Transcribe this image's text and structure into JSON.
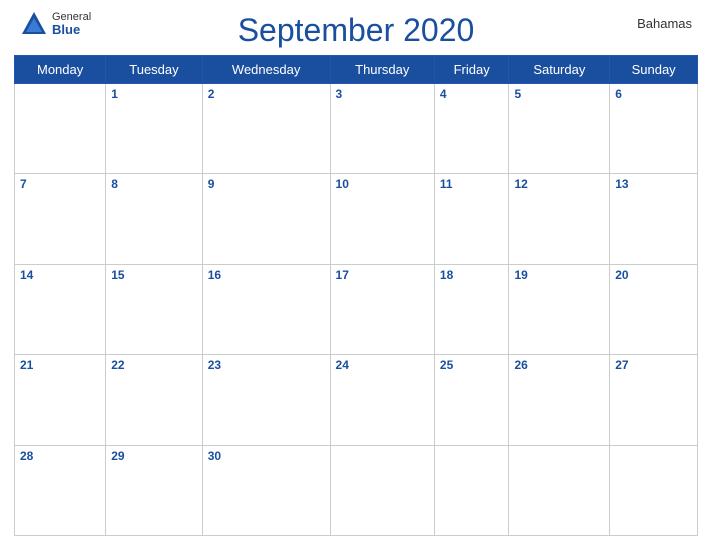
{
  "header": {
    "title": "September 2020",
    "country": "Bahamas",
    "logo": {
      "general": "General",
      "blue": "Blue"
    }
  },
  "calendar": {
    "weekdays": [
      "Monday",
      "Tuesday",
      "Wednesday",
      "Thursday",
      "Friday",
      "Saturday",
      "Sunday"
    ],
    "weeks": [
      {
        "days": [
          "",
          "1",
          "2",
          "3",
          "4",
          "5",
          "6"
        ]
      },
      {
        "days": [
          "7",
          "8",
          "9",
          "10",
          "11",
          "12",
          "13"
        ]
      },
      {
        "days": [
          "14",
          "15",
          "16",
          "17",
          "18",
          "19",
          "20"
        ]
      },
      {
        "days": [
          "21",
          "22",
          "23",
          "24",
          "25",
          "26",
          "27"
        ]
      },
      {
        "days": [
          "28",
          "29",
          "30",
          "",
          "",
          "",
          ""
        ]
      }
    ]
  }
}
